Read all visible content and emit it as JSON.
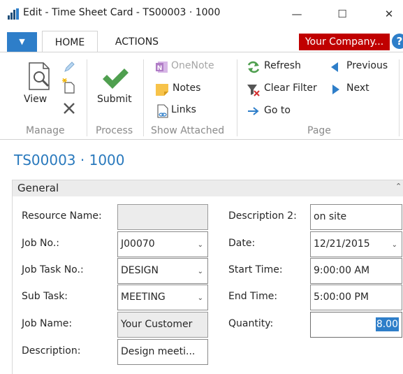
{
  "window": {
    "title": "Edit - Time Sheet Card - TS00003 · 1000",
    "minimize_glyph": "—",
    "maximize_glyph": "☐",
    "close_glyph": "✕"
  },
  "ribbon_tabs": {
    "file_glyph": "▼",
    "home": "HOME",
    "actions": "ACTIONS",
    "company": "Your Company...",
    "help_glyph": "?"
  },
  "ribbon": {
    "manage": {
      "label": "Manage",
      "view": "View"
    },
    "process": {
      "label": "Process",
      "submit": "Submit"
    },
    "show_attached": {
      "label": "Show Attached",
      "onenote": "OneNote",
      "notes": "Notes",
      "links": "Links"
    },
    "page": {
      "label": "Page",
      "refresh": "Refresh",
      "clear_filter": "Clear Filter",
      "go_to": "Go to",
      "previous": "Previous",
      "next": "Next"
    }
  },
  "card": {
    "title": "TS00003 · 1000"
  },
  "general": {
    "title": "General",
    "collapse_glyph": "⌃",
    "resource_name": {
      "label": "Resource Name:",
      "value": ""
    },
    "job_no": {
      "label": "Job No.:",
      "value": "J00070"
    },
    "job_task_no": {
      "label": "Job Task No.:",
      "value": "DESIGN"
    },
    "sub_task": {
      "label": "Sub Task:",
      "value": "MEETING"
    },
    "job_name": {
      "label": "Job Name:",
      "value": "Your Customer"
    },
    "description": {
      "label": "Description:",
      "value": "Design meeti..."
    },
    "description_2": {
      "label": "Description 2:",
      "value": "on site"
    },
    "date": {
      "label": "Date:",
      "value": "12/21/2015"
    },
    "start_time": {
      "label": "Start Time:",
      "value": "9:00:00 AM"
    },
    "end_time": {
      "label": "End Time:",
      "value": "5:00:00 PM"
    },
    "quantity": {
      "label": "Quantity:",
      "value": "8.00"
    },
    "dropdown_glyph": "⌄"
  },
  "colors": {
    "accent": "#2e7ec9",
    "title_blue": "#2979bd",
    "company_red": "#c00000",
    "check_green": "#4f9f4f"
  }
}
